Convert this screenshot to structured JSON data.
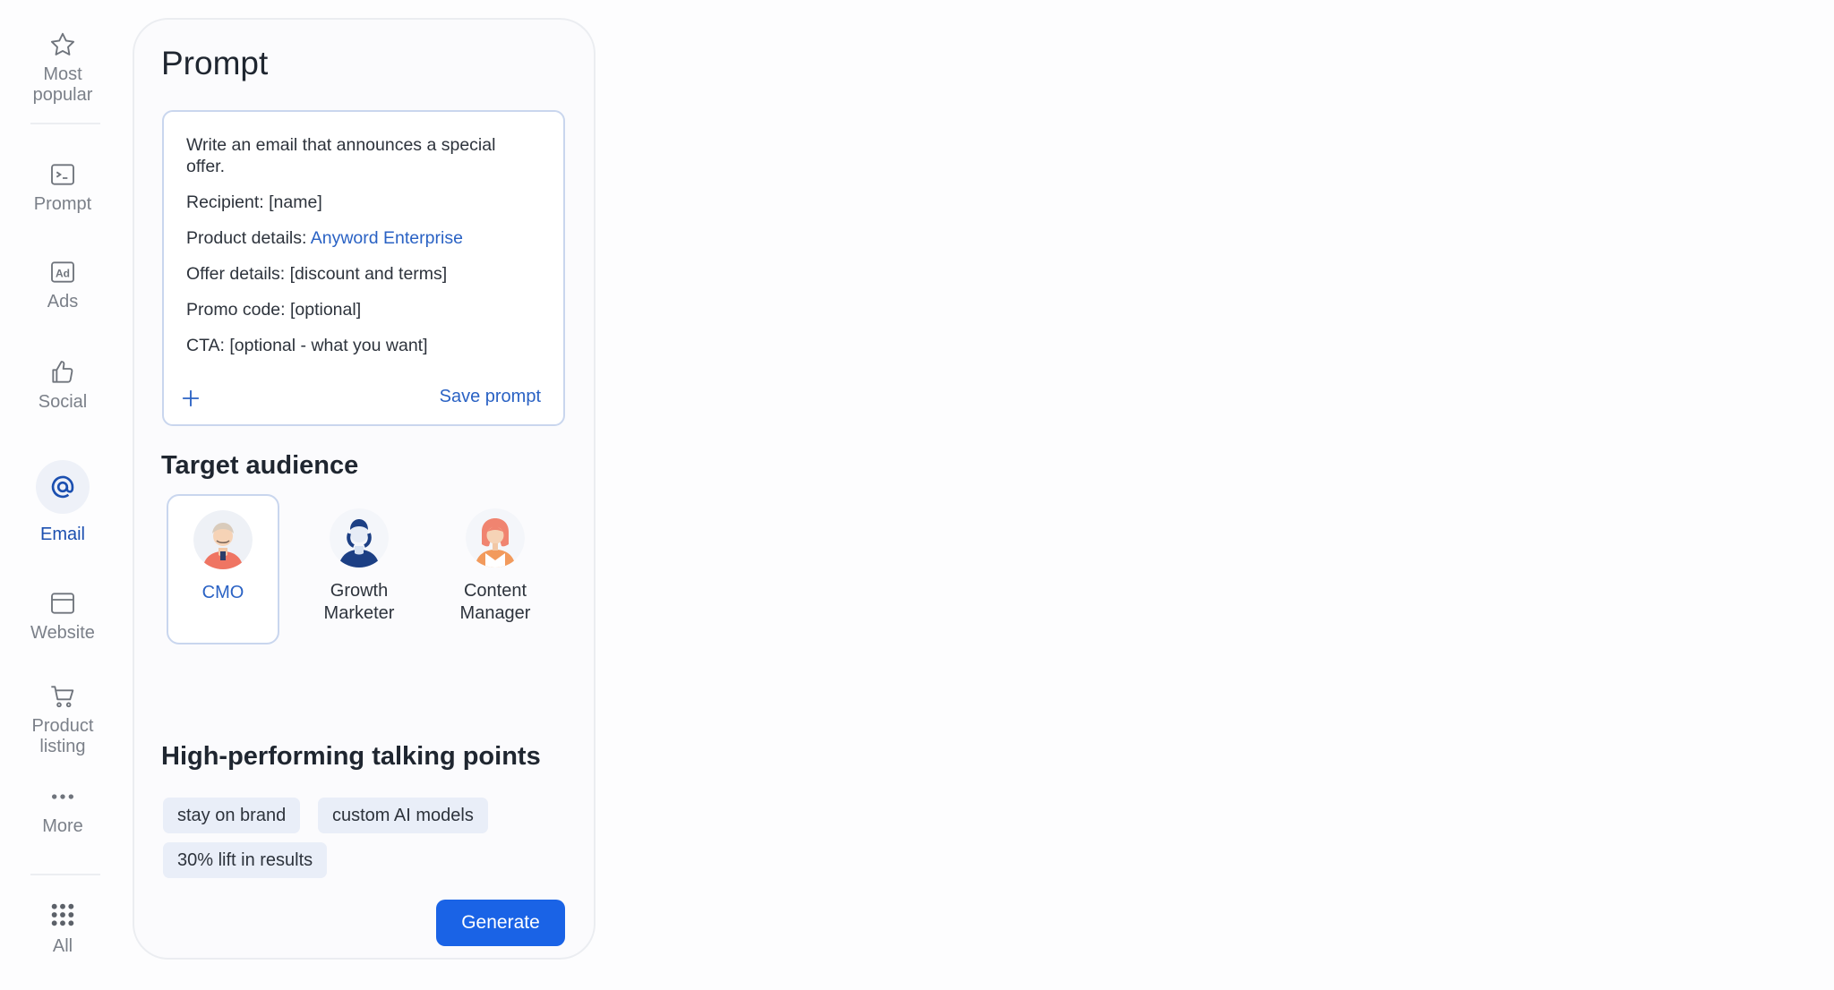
{
  "sidebar": {
    "items": [
      {
        "label": "Most popular",
        "icon": "star-icon"
      },
      {
        "label": "Prompt",
        "icon": "terminal-icon"
      },
      {
        "label": "Ads",
        "icon": "ad-icon"
      },
      {
        "label": "Social",
        "icon": "thumbs-up-icon"
      },
      {
        "label": "Email",
        "icon": "at-sign-icon",
        "active": true
      },
      {
        "label": "Website",
        "icon": "browser-window-icon"
      },
      {
        "label": "Product listing",
        "icon": "cart-icon"
      },
      {
        "label": "More",
        "icon": "more-dots-icon"
      },
      {
        "label": "All",
        "icon": "grid-icon"
      }
    ]
  },
  "panel": {
    "title": "Prompt",
    "prompt": {
      "line1": "Write an email that announces a special offer.",
      "recipient": "Recipient: [name]",
      "product_prefix": "Product details: ",
      "product_link": "Anyword Enterprise",
      "offer": "Offer details: [discount and terms]",
      "promo": "Promo code: [optional]",
      "cta": "CTA: [optional - what you want]",
      "save_label": "Save prompt"
    },
    "audience": {
      "title": "Target audience",
      "personas": [
        {
          "name": "CMO",
          "selected": true
        },
        {
          "name": "Growth Marketer",
          "selected": false
        },
        {
          "name": "Content Manager",
          "selected": false
        }
      ]
    },
    "talking_points": {
      "title": "High-performing talking points",
      "chips": [
        "stay on brand",
        "custom AI models",
        "30% lift in results"
      ]
    },
    "generate_label": "Generate"
  },
  "colors": {
    "accent": "#1a63e6",
    "link": "#2a62c4",
    "chip_bg": "#e9eef8",
    "border": "#c9d6ee"
  }
}
